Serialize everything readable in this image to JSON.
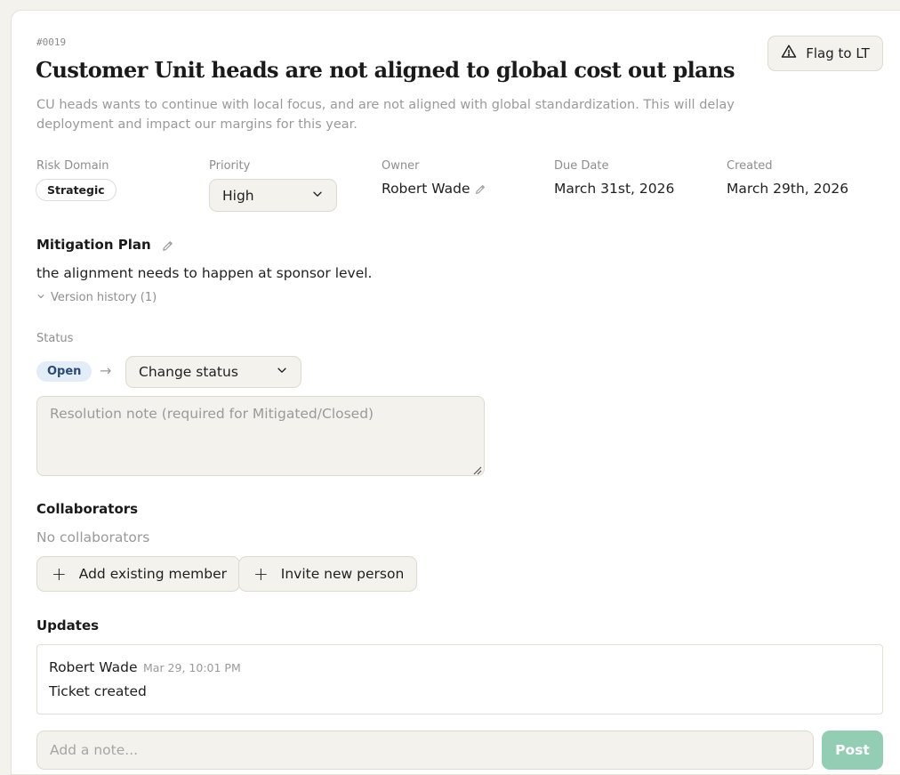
{
  "ticket": {
    "id": "#0019",
    "title": "Customer Unit heads are not aligned to global cost out plans",
    "description": "CU heads wants to continue with local focus, and are not aligned with global standardization. This will delay deployment and impact our margins for this year.",
    "flag_button": "Flag to LT"
  },
  "meta": {
    "risk_domain": {
      "label": "Risk Domain",
      "value": "Strategic"
    },
    "priority": {
      "label": "Priority",
      "value": "High"
    },
    "owner": {
      "label": "Owner",
      "value": "Robert Wade"
    },
    "due_date": {
      "label": "Due Date",
      "value": "March 31st, 2026"
    },
    "created": {
      "label": "Created",
      "value": "March 29th, 2026"
    }
  },
  "mitigation": {
    "title": "Mitigation Plan",
    "text": "the alignment needs to happen at sponsor level.",
    "version_history": "Version history (1)"
  },
  "status": {
    "label": "Status",
    "current": "Open",
    "arrow": "→",
    "change_label": "Change status",
    "resolution_placeholder": "Resolution note (required for Mitigated/Closed)"
  },
  "collaborators": {
    "title": "Collaborators",
    "empty_text": "No collaborators",
    "add_button": "Add existing member",
    "invite_button": "Invite new person"
  },
  "updates": {
    "title": "Updates",
    "items": [
      {
        "author": "Robert Wade",
        "time": "Mar 29, 10:01 PM",
        "text": "Ticket created"
      }
    ],
    "note_placeholder": "Add a note...",
    "post_button": "Post"
  },
  "colors": {
    "page_bg": "#f4f2ec",
    "open_badge_bg": "#e3edf7",
    "open_badge_text": "#2b4a73",
    "post_button": "#93cdb4"
  },
  "icons": {
    "flag": "warning-triangle-icon",
    "dropdown": "chevron-down-icon",
    "edit": "pencil-icon",
    "add": "plus-icon"
  }
}
